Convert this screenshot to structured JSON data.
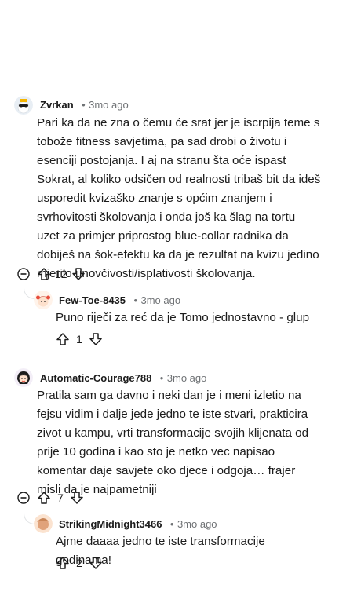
{
  "comments": [
    {
      "username": "Zvrkan",
      "separator": "•",
      "time": "3mo ago",
      "text": "Pari ka da ne zna o čemu će srat jer je iscrpija teme s tobože fitness savjetima, pa sad drobi o životu i esenciji postojanja. I aj na stranu šta oće ispast Sokrat, al koliko odsičen od realnosti tribaš bit da ideš usporedit kvizaško znanje s općim znanjem i svrhovitosti školovanja i onda još ka šlag na tortu uzet za primjer priprostog blue-collar radnika da dobiješ na šok-efektu ka da je rezultat na kvizu jedino mjerilo unovčivosti/isplativosti školovanja.",
      "score": "12"
    },
    {
      "username": "Few-Toe-8435",
      "separator": "•",
      "time": "3mo ago",
      "text": "Puno riječi za reć da je Tomo jednostavno - glup",
      "score": "1"
    },
    {
      "username": "Automatic-Courage788",
      "separator": "•",
      "time": "3mo ago",
      "text": "Pratila sam ga davno i neki dan je i meni izletio na fejsu vidim i dalje jede jedno te iste stvari, prakticira zivot u kampu, vrti transformacije svojih klijenata od prije 10 godina i kao sto je netko vec napisao komentar daje savjete oko djece i odgoja… frajer misli da je najpametniji",
      "score": "7"
    },
    {
      "username": "StrikingMidnight3466",
      "separator": "•",
      "time": "3mo ago",
      "text": "Ajme daaaa jedno te iste transformacije godinama!",
      "score": "2"
    }
  ],
  "icons": {
    "upvote": "arrow-up-icon",
    "downvote": "arrow-down-icon",
    "collapse": "minus-circle-icon"
  }
}
